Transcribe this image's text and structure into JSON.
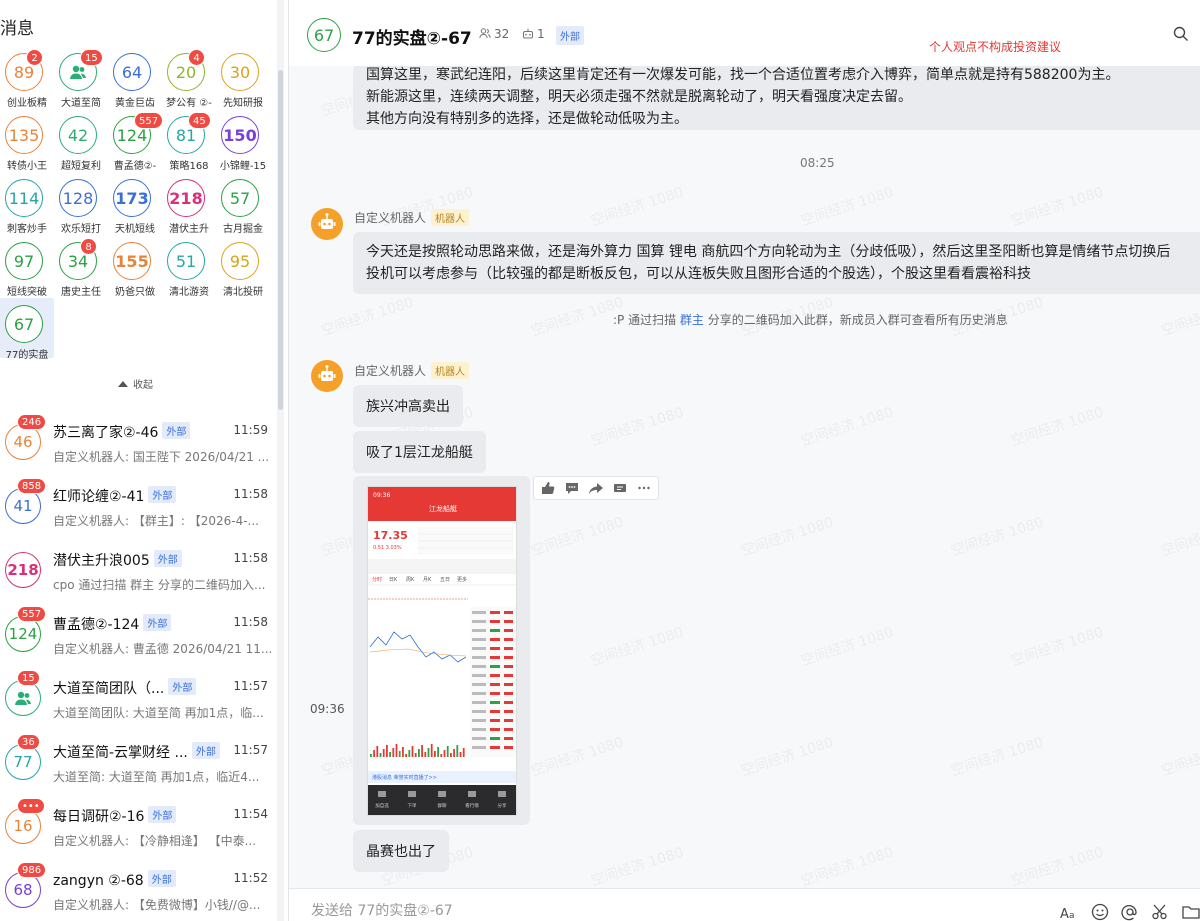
{
  "left": {
    "title": "消息",
    "collapse_label": "收起",
    "grid": [
      {
        "label": "创业板精",
        "value": "89",
        "badge": "2",
        "color": "#e8833a",
        "bold": false
      },
      {
        "label": "大道至简",
        "value": "",
        "icon": "group-icon",
        "badge": "15",
        "color": "#2bae75",
        "bold": false
      },
      {
        "label": "黄金巨齿",
        "value": "64",
        "badge": "",
        "color": "#3a6fd8",
        "bold": false
      },
      {
        "label": "梦公有 ②-",
        "value": "20",
        "badge": "4",
        "color": "#8fb52a",
        "bold": false
      },
      {
        "label": "先知研报",
        "value": "30",
        "badge": "",
        "color": "#d9a31e",
        "bold": false
      },
      {
        "label": "转债小王",
        "value": "135",
        "badge": "",
        "color": "#e8833a",
        "bold": false
      },
      {
        "label": "超短复利",
        "value": "42",
        "badge": "",
        "color": "#2bae75",
        "bold": false
      },
      {
        "label": "曹孟德②-",
        "value": "124",
        "badge": "557",
        "color": "#2ba245",
        "bold": false
      },
      {
        "label": "策略168",
        "value": "81",
        "badge": "45",
        "color": "#26a6a6",
        "bold": false
      },
      {
        "label": "小锦鲤-15",
        "value": "150",
        "badge": "",
        "color": "#7a3fd8",
        "bold": true
      },
      {
        "label": "刺客炒手",
        "value": "114",
        "badge": "",
        "color": "#26a6a6",
        "bold": false
      },
      {
        "label": "欢乐短打",
        "value": "128",
        "badge": "",
        "color": "#3a6fd8",
        "bold": false
      },
      {
        "label": "天机短线",
        "value": "173",
        "badge": "",
        "color": "#3a6fd8",
        "bold": true
      },
      {
        "label": "潜伏主升",
        "value": "218",
        "badge": "",
        "color": "#d8307a",
        "bold": true
      },
      {
        "label": "古月掘金",
        "value": "57",
        "badge": "",
        "color": "#2ba245",
        "bold": false
      },
      {
        "label": "短线突破",
        "value": "97",
        "badge": "",
        "color": "#2ba245",
        "bold": false
      },
      {
        "label": "唐史主任",
        "value": "34",
        "badge": "8",
        "color": "#2ba245",
        "bold": false
      },
      {
        "label": "奶爸只做",
        "value": "155",
        "badge": "",
        "color": "#e8833a",
        "bold": true
      },
      {
        "label": "清北游资",
        "value": "51",
        "badge": "",
        "color": "#26a6a6",
        "bold": false
      },
      {
        "label": "清北投研",
        "value": "95",
        "badge": "",
        "color": "#d9a31e",
        "bold": false
      },
      {
        "label": "77的实盘",
        "value": "67",
        "badge": "",
        "color": "#2ba245",
        "bold": false,
        "selected": true
      }
    ],
    "conversations": [
      {
        "avatar": "46",
        "badge": "246",
        "color": "#e8833a",
        "name": "苏三离了家②-46",
        "tag": "外部",
        "time": "11:59",
        "preview": "自定义机器人: 国王陛下 2026/04/21 ..."
      },
      {
        "avatar": "41",
        "badge": "858",
        "color": "#3a6fd8",
        "name": "红师论缠②-41",
        "tag": "外部",
        "time": "11:58",
        "preview": "自定义机器人: 【群主】: 【2026-4-..."
      },
      {
        "avatar": "218",
        "badge": "",
        "color": "#d8307a",
        "bold": true,
        "name": "潜伏主升浪005",
        "tag": "外部",
        "time": "11:58",
        "preview": "cpo 通过扫描 群主 分享的二维码加入..."
      },
      {
        "avatar": "124",
        "badge": "557",
        "color": "#2ba245",
        "name": "曹孟德②-124",
        "tag": "外部",
        "time": "11:58",
        "preview": "自定义机器人: 曹孟德 2026/04/21 11..."
      },
      {
        "avatar": "",
        "icon": "group-icon",
        "badge": "15",
        "color": "#2bae75",
        "name": "大道至简团队（...",
        "tag": "外部",
        "time": "11:57",
        "preview": "大道至简团队: 大道至简 再加1点，临..."
      },
      {
        "avatar": "77",
        "badge": "36",
        "color": "#26a6a6",
        "name": "大道至简-云掌财经 ...",
        "tag": "外部",
        "time": "11:57",
        "preview": "大道至简: 大道至简 再加1点，临近4..."
      },
      {
        "avatar": "16",
        "badge": "•••",
        "color": "#e8833a",
        "name": "每日调研②-16",
        "tag": "外部",
        "time": "11:54",
        "preview": "自定义机器人: 【冷静相逢】 【中泰..."
      },
      {
        "avatar": "68",
        "badge": "986",
        "color": "#7a3fd8",
        "name": "zangyn ②-68",
        "tag": "外部",
        "time": "11:52",
        "preview": "自定义机器人: 【免费微博】小钱//@..."
      }
    ]
  },
  "header": {
    "avatar": "67",
    "title": "77的实盘②-67",
    "members": "32",
    "bots": "1",
    "tag": "外部",
    "note": "个人观点不构成投资建议"
  },
  "chat": {
    "watermark": "空间经济 1080",
    "top_bubble_lines": [
      "国算这里，寒武纪连阳，后续这里肯定还有一次爆发可能，找一个合适位置考虑介入博弈，简单点就是持有588200为主。",
      "新能源这里，连续两天调整，明天必须走强不然就是脱离轮动了，明天看强度决定去留。",
      "其他方向没有特别多的选择，还是做轮动低吸为主。"
    ],
    "time1": "08:25",
    "sender1": "自定义机器人",
    "bot_tag": "机器人",
    "msg1_lines": [
      "今天还是按照轮动思路来做，还是海外算力 国算 锂电 商航四个方向轮动为主（分歧低吸），然后这里圣阳断也算是情绪节点切换后",
      "投机可以考虑参与（比较强的都是断板反包，可以从连板失败且图形合适的个股选），个股这里看看震裕科技"
    ],
    "sys_prefix": ":P 通过扫描 ",
    "sys_highlight": "群主",
    "sys_suffix": " 分享的二维码加入此群，新成员入群可查看所有历史消息",
    "sender2": "自定义机器人",
    "msg2": "族兴冲高卖出",
    "msg3": "吸了1层江龙船艇",
    "shot_time": "09:36",
    "msg4": "晶赛也出了"
  },
  "screenshot": {
    "status_time": "09:36",
    "stock_name": "江龙船艇",
    "price": "17.35",
    "change": "0.51  3.03%",
    "tabs": [
      "分时",
      "日K",
      "周K",
      "月K",
      "五日",
      "更多"
    ],
    "banner": "港股消息 荣誉实时直播了>>",
    "bottom": [
      "加自选",
      "下单",
      "群聊",
      "看行情",
      "分享"
    ]
  },
  "composer": {
    "placeholder": "发送给 77的实盘②-67"
  }
}
